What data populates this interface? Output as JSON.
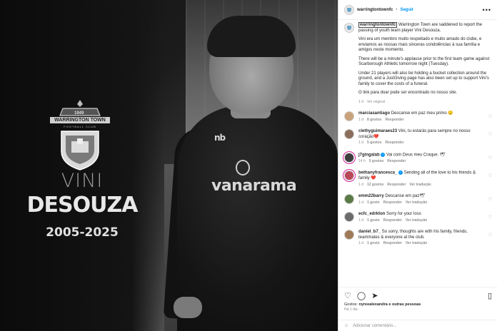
{
  "post": {
    "account": "warringtontownfc",
    "follow_label": "Seguir",
    "header_dot": "•",
    "more": "•••"
  },
  "image": {
    "crest_year": "1949",
    "crest_name": "WARRINGTON TOWN",
    "crest_sub": "FOOTBALL CLUB",
    "first_name": "VINI",
    "last_name": "DESOUZA",
    "years": "2005-2025",
    "shirt_brand": "nb",
    "shirt_sponsor": "vanarama"
  },
  "caption": {
    "user": "warringtontownfc",
    "p1": "Warrington Town are saddened to report the passing of youth team player Vini Desouza.",
    "p2": "Vini era um membro muito respeitado e muito amado do clube, e enviamos as nossas mais sinceras condolências à sua família e amigos neste momento.",
    "p3": "There will be a minute's applause prior to the first team game against Scarborough Athletic tomorrow night (Tuesday).",
    "p4": "Under 21 players will also be holding a bucket collection around the ground, and a JustGiving page has also been set up to support Vini's family to cover the costs of a funeral.",
    "p5": "O link para doar pode ser encontrado no nosso site.",
    "time": "1 d",
    "translation": "Ver original"
  },
  "comments": [
    {
      "user": "marciasantiago",
      "text": "Descanse em paz meu primo 😔",
      "time": "1 d",
      "likes": "8 gostos",
      "reply": "Responder",
      "translate": "",
      "verified": false
    },
    {
      "user": "clethyguimaraes23",
      "text": "Vini, tu estarás para sempre no nosso coração❤️",
      "time": "1 d",
      "likes": "5 gostos",
      "reply": "Responder",
      "translate": "",
      "verified": false
    },
    {
      "user": "j7gingalab",
      "text": "Vai com Deus meu Craque. 🕊",
      "time": "14 h",
      "likes": "5 gostos",
      "reply": "Responder",
      "translate": "",
      "verified": true
    },
    {
      "user": "bethanyfrancesca_",
      "text": "Sending all of the love to his friends & family ❤️",
      "time": "1 d",
      "likes": "12 gostos",
      "reply": "Responder",
      "translate": "Ver tradução",
      "verified": true
    },
    {
      "user": "emm22barry",
      "text": "Descanse em paz🕊",
      "time": "1 d",
      "likes": "1 gosto",
      "reply": "Responder",
      "translate": "Ver tradução",
      "verified": false
    },
    {
      "user": "ecfc_edrkton",
      "text": "Sorry for your loss",
      "time": "1 d",
      "likes": "1 gosto",
      "reply": "Responder",
      "translate": "Ver tradução",
      "verified": false
    },
    {
      "user": "daniel_b7_",
      "text": "So sorry, thoughts are with his family, friends, teammates & everyone at the club.",
      "time": "1 d",
      "likes": "1 gosto",
      "reply": "Responder",
      "translate": "Ver tradução",
      "verified": false
    }
  ],
  "footer": {
    "likes_prefix": "Gostos:",
    "likes_text": "nyreealexandra e outras pessoas",
    "time": "Há 1 dia",
    "add_comment_placeholder": "Adicionar comentário..."
  },
  "icons": {
    "like": "heart-icon",
    "comment": "comment-icon",
    "share": "share-icon",
    "save": "bookmark-icon",
    "emoji": "emoji-icon"
  }
}
